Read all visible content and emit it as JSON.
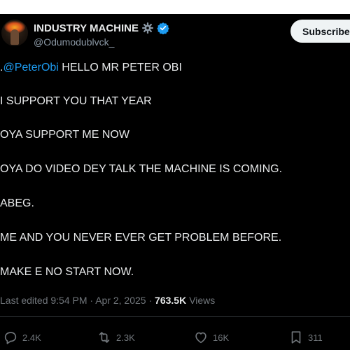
{
  "tweet": {
    "author": {
      "display_name": "INDUSTRY MACHINE",
      "handle": "@Odumodublvck_",
      "badges": [
        "gear-icon",
        "verified-icon"
      ]
    },
    "subscribe_label": "Subscribe",
    "prefix_dot": ".",
    "mention": "@PeterObi",
    "first_line_rest": " HELLO MR PETER OBI",
    "lines": [
      "I SUPPORT YOU THAT YEAR",
      "OYA SUPPORT ME NOW",
      "OYA DO VIDEO DEY TALK THE MACHINE IS COMING.",
      "ABEG.",
      "ME AND YOU NEVER EVER GET PROBLEM BEFORE.",
      "MAKE E NO START NOW."
    ],
    "meta": {
      "edited_label": "Last edited 9:54 PM · Apr 2, 2025 · ",
      "views_count": "763.5K",
      "views_label": "Views"
    },
    "actions": {
      "replies": "2.4K",
      "reposts": "2.3K",
      "likes": "16K",
      "bookmarks": "311"
    }
  },
  "colors": {
    "background": "#000000",
    "text": "#e7e9ea",
    "secondary": "#71767b",
    "link": "#1d9bf0",
    "verified": "#1d9bf0",
    "subscribe_bg": "#eff3f4"
  },
  "icons": {
    "reply": "reply-icon",
    "repost": "repost-icon",
    "like": "heart-icon",
    "bookmark": "bookmark-icon"
  }
}
